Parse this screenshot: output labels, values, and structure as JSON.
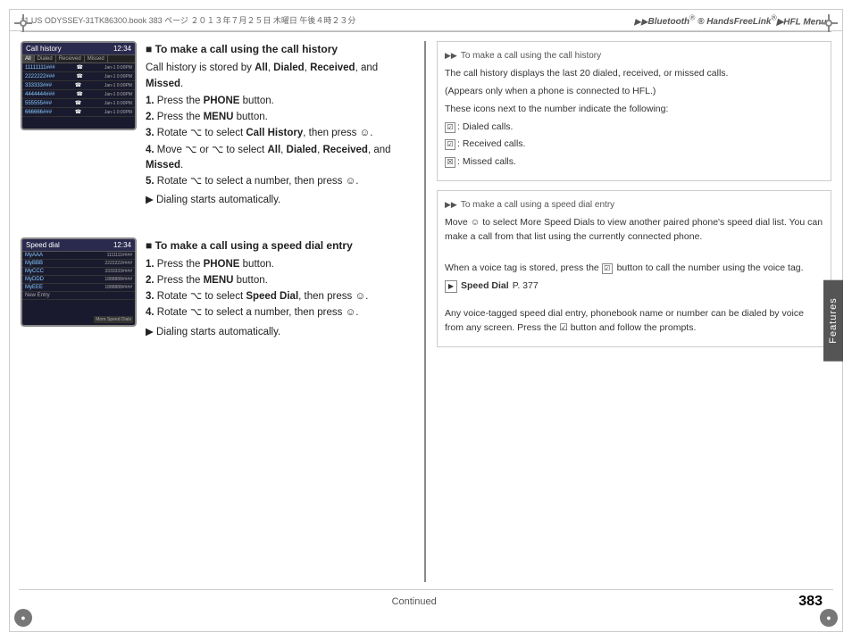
{
  "header": {
    "file_info": "11 US ODYSSEY-31TK86300.book  383 ページ  ２０１３年７月２５日  木曜日  午後４時２３分",
    "title_part1": "Bluetooth",
    "title_part2": "® HandsFreeLink",
    "title_part3": "®",
    "title_suffix": "▶HFL Menus"
  },
  "section1": {
    "screen": {
      "title": "Call history",
      "time": "12:34",
      "tabs": [
        "All",
        "Dialed",
        "Received",
        "Missed"
      ],
      "rows": [
        {
          "num": "11111111###",
          "info": "Jan-1  0:00PM",
          "icon": "✆"
        },
        {
          "num": "2222222###",
          "info": "Jan-1  0:00PM",
          "icon": "✆"
        },
        {
          "num": "333333####",
          "info": "Jan-1  0:00PM",
          "icon": "✆"
        },
        {
          "num": "4444444####",
          "info": "Jan-1  0:00PM",
          "icon": "✆"
        },
        {
          "num": "555555####",
          "info": "Jan-1  0:00PM",
          "icon": "✆"
        },
        {
          "num": "666666####",
          "info": "Jan-1  0:00PM",
          "icon": "✆"
        }
      ]
    },
    "title": "■ To make a call using the call history",
    "intro": "Call history is stored by All, Dialed, Received, and Missed.",
    "steps": [
      "1. Press the PHONE button.",
      "2. Press the MENU button.",
      "3. Rotate ⌘ to select Call History, then press ☺.",
      "4. Move ⌘ or ⌘ to select All, Dialed, Received, and Missed.",
      "5. Rotate ⌘ to select a number, then press ☺."
    ],
    "note": "▶ Dialing starts automatically."
  },
  "section2": {
    "screen": {
      "title": "Speed dial",
      "time": "12:34",
      "rows": [
        {
          "name": "MyAAA",
          "num": "1111111####"
        },
        {
          "name": "MyBBB",
          "num": "2222222####"
        },
        {
          "name": "MyCCC",
          "num": "3333333####"
        },
        {
          "name": "MyDDD",
          "num": "1888888####"
        },
        {
          "name": "MyEEE",
          "num": "1888888####"
        },
        {
          "name": "New Entry",
          "num": ""
        }
      ],
      "more": "More Speed Dials"
    },
    "title": "■ To make a call using a speed dial entry",
    "steps": [
      "1. Press the PHONE button.",
      "2. Press the MENU button.",
      "3. Rotate ⌘ to select Speed Dial, then press ☺.",
      "4. Rotate ⌘ to select a number, then press ☺."
    ],
    "note": "▶ Dialing starts automatically."
  },
  "info_box1": {
    "title": "To make a call using the call history",
    "para1": "The call history displays the last 20 dialed, received, or missed calls.",
    "para2": "(Appears only when a phone is connected to HFL.)",
    "para3": "These icons next to the number indicate the following:",
    "icons": [
      {
        "symbol": "☑",
        "label": "Dialed calls."
      },
      {
        "symbol": "☑",
        "label": "Received calls."
      },
      {
        "symbol": "☒",
        "label": "Missed calls."
      }
    ]
  },
  "info_box2": {
    "title": "To make a call using a speed dial entry",
    "para1": "Move ☺ to select More Speed Dials to view another paired phone's speed dial list. You can make a call from that list using the currently connected phone.",
    "para2": "When a voice tag is stored, press the ☑ button to call the number using the voice tag.",
    "ref_label": "Speed Dial",
    "ref_page": "P. 377",
    "para3": "Any voice-tagged speed dial entry, phonebook name or number can be dialed by voice from any screen. Press the ☑ button and follow the prompts."
  },
  "footer": {
    "continued": "Continued",
    "page": "383"
  },
  "features_tab": "Features"
}
